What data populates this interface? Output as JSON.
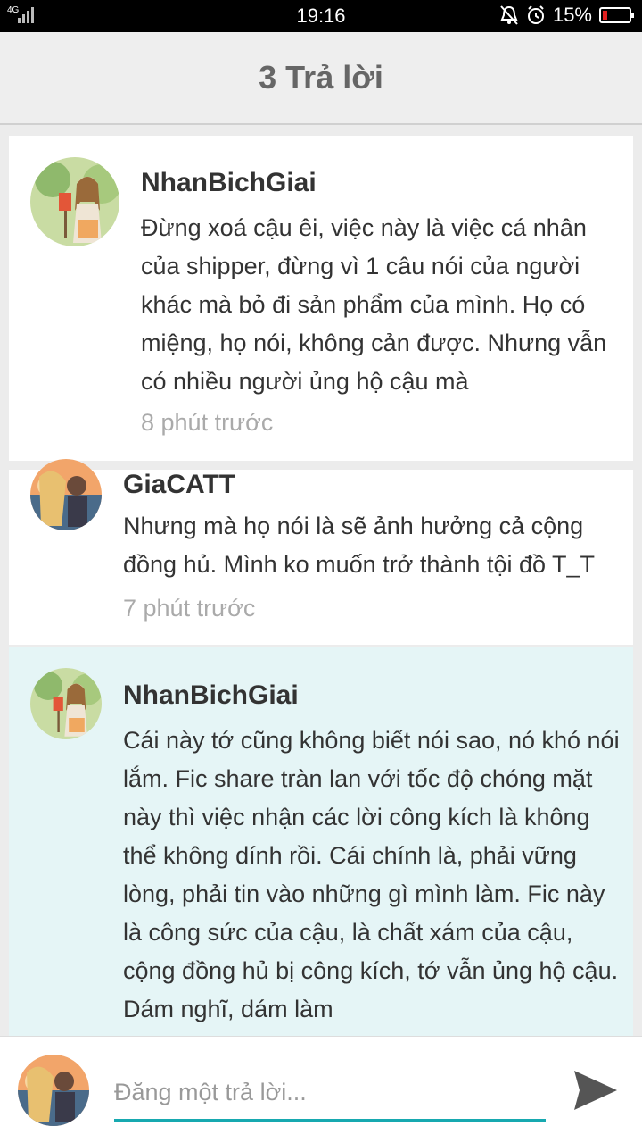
{
  "status_bar": {
    "network": "4G",
    "time": "19:16",
    "battery_percent": "15%",
    "battery_level": 0.15,
    "icons": [
      "signal-icon",
      "notification-muted-icon",
      "alarm-icon",
      "battery-icon"
    ]
  },
  "header": {
    "title": "3 Trả lời"
  },
  "comments": [
    {
      "author": "NhanBichGiai",
      "body": "Đừng xoá cậu êi, việc này là việc cá nhân của shipper, đừng vì 1 câu nói của người khác mà bỏ đi sản phẩm của mình. Họ có miệng, họ nói, không cản được. Nhưng vẫn có nhiều người ủng hộ cậu mà",
      "time": "8 phút trước"
    },
    {
      "author": "GiaCATT",
      "body": "Nhưng mà họ nói là sẽ ảnh hưởng cả cộng đồng hủ. Mình ko muốn trở thành tội đồ T_T",
      "time": "7 phút trước"
    },
    {
      "author": "NhanBichGiai",
      "body": "Cái này tớ cũng không biết nói sao, nó khó nói lắm. Fic share tràn lan với tốc độ chóng mặt này thì việc nhận các lời công kích là không thể không dính rồi. Cái chính là, phải vững lòng, phải tin vào những gì mình làm. Fic này là công sức của cậu, là chất xám của cậu, cộng đồng hủ bị công kích, tớ vẫn ủng hộ cậu. Dám nghĩ, dám làm"
    }
  ],
  "reply": {
    "placeholder": "Đăng một trả lời..."
  },
  "colors": {
    "accent": "#17a9b0",
    "highlight_bg": "#e5f5f6"
  }
}
